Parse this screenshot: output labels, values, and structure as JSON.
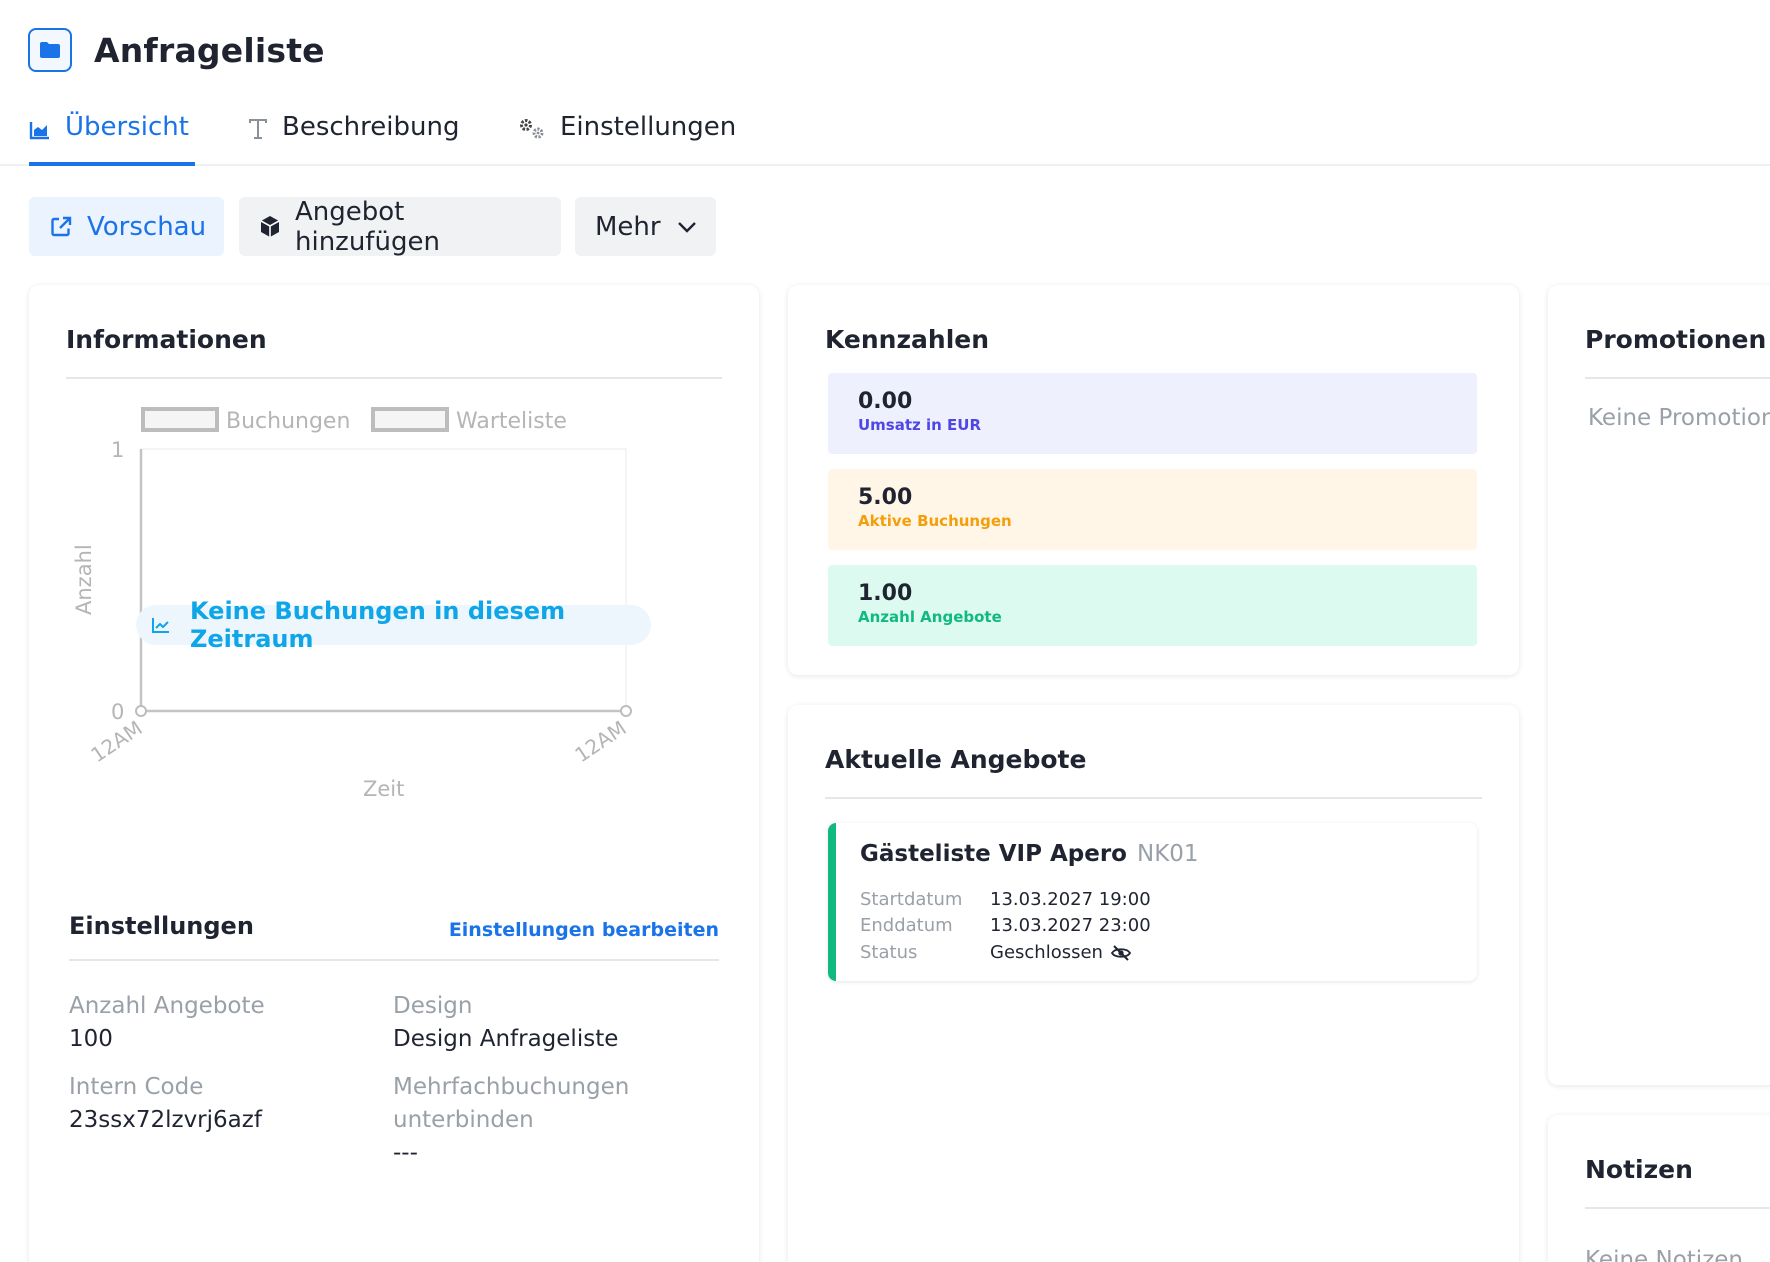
{
  "header": {
    "title": "Anfrageliste",
    "icon": "folder-icon"
  },
  "tabs": [
    {
      "label": "Übersicht",
      "icon": "area-chart-icon",
      "active": true
    },
    {
      "label": "Beschreibung",
      "icon": "text-icon",
      "active": false
    },
    {
      "label": "Einstellungen",
      "icon": "gears-icon",
      "active": false
    }
  ],
  "actions": {
    "preview": "Vorschau",
    "add_offer": "Angebot hinzufügen",
    "more": "Mehr"
  },
  "info_card": {
    "title": "Informationen",
    "empty_message": "Keine Buchungen in diesem Zeitraum",
    "settings_title": "Einstellungen",
    "settings_link": "Einstellungen bearbeiten",
    "fields": [
      {
        "label": "Anzahl Angebote",
        "value": "100"
      },
      {
        "label": "Design",
        "value": "Design Anfrageliste"
      },
      {
        "label": "Intern Code",
        "value": "23ssx72lzvrj6azf"
      },
      {
        "label": "Mehrfachbuchungen unterbinden",
        "value": "---"
      }
    ]
  },
  "chart_data": {
    "type": "line",
    "legend": [
      "Buchungen",
      "Warteliste"
    ],
    "series": [
      {
        "name": "Buchungen",
        "values": []
      },
      {
        "name": "Warteliste",
        "values": []
      }
    ],
    "x_ticks": [
      "12AM",
      "12AM"
    ],
    "y_ticks": [
      "0",
      "1"
    ],
    "ylim": [
      0,
      1
    ],
    "xlabel": "Zeit",
    "ylabel": "Anzahl",
    "legend_position": "top"
  },
  "kpi_card": {
    "title": "Kennzahlen",
    "tiles": [
      {
        "value": "0.00",
        "label": "Umsatz in EUR"
      },
      {
        "value": "5.00",
        "label": "Aktive Buchungen"
      },
      {
        "value": "1.00",
        "label": "Anzahl Angebote"
      }
    ]
  },
  "offers_card": {
    "title": "Aktuelle Angebote",
    "items": [
      {
        "name": "Gästeliste VIP Apero",
        "code": "NK01",
        "rows": [
          {
            "key": "Startdatum",
            "value": "13.03.2027 19:00"
          },
          {
            "key": "Enddatum",
            "value": "13.03.2027 23:00"
          },
          {
            "key": "Status",
            "value": "Geschlossen",
            "icon": "eye-slash-icon"
          }
        ]
      }
    ]
  },
  "promo_card": {
    "title": "Promotionen",
    "empty": "Keine Promotionen"
  },
  "notes_card": {
    "title": "Notizen",
    "empty": "Keine Notizen"
  },
  "colors": {
    "primary": "#1a73e8",
    "accent_green": "#10b981",
    "accent_orange": "#f59e0b",
    "accent_indigo": "#4f46e5"
  }
}
